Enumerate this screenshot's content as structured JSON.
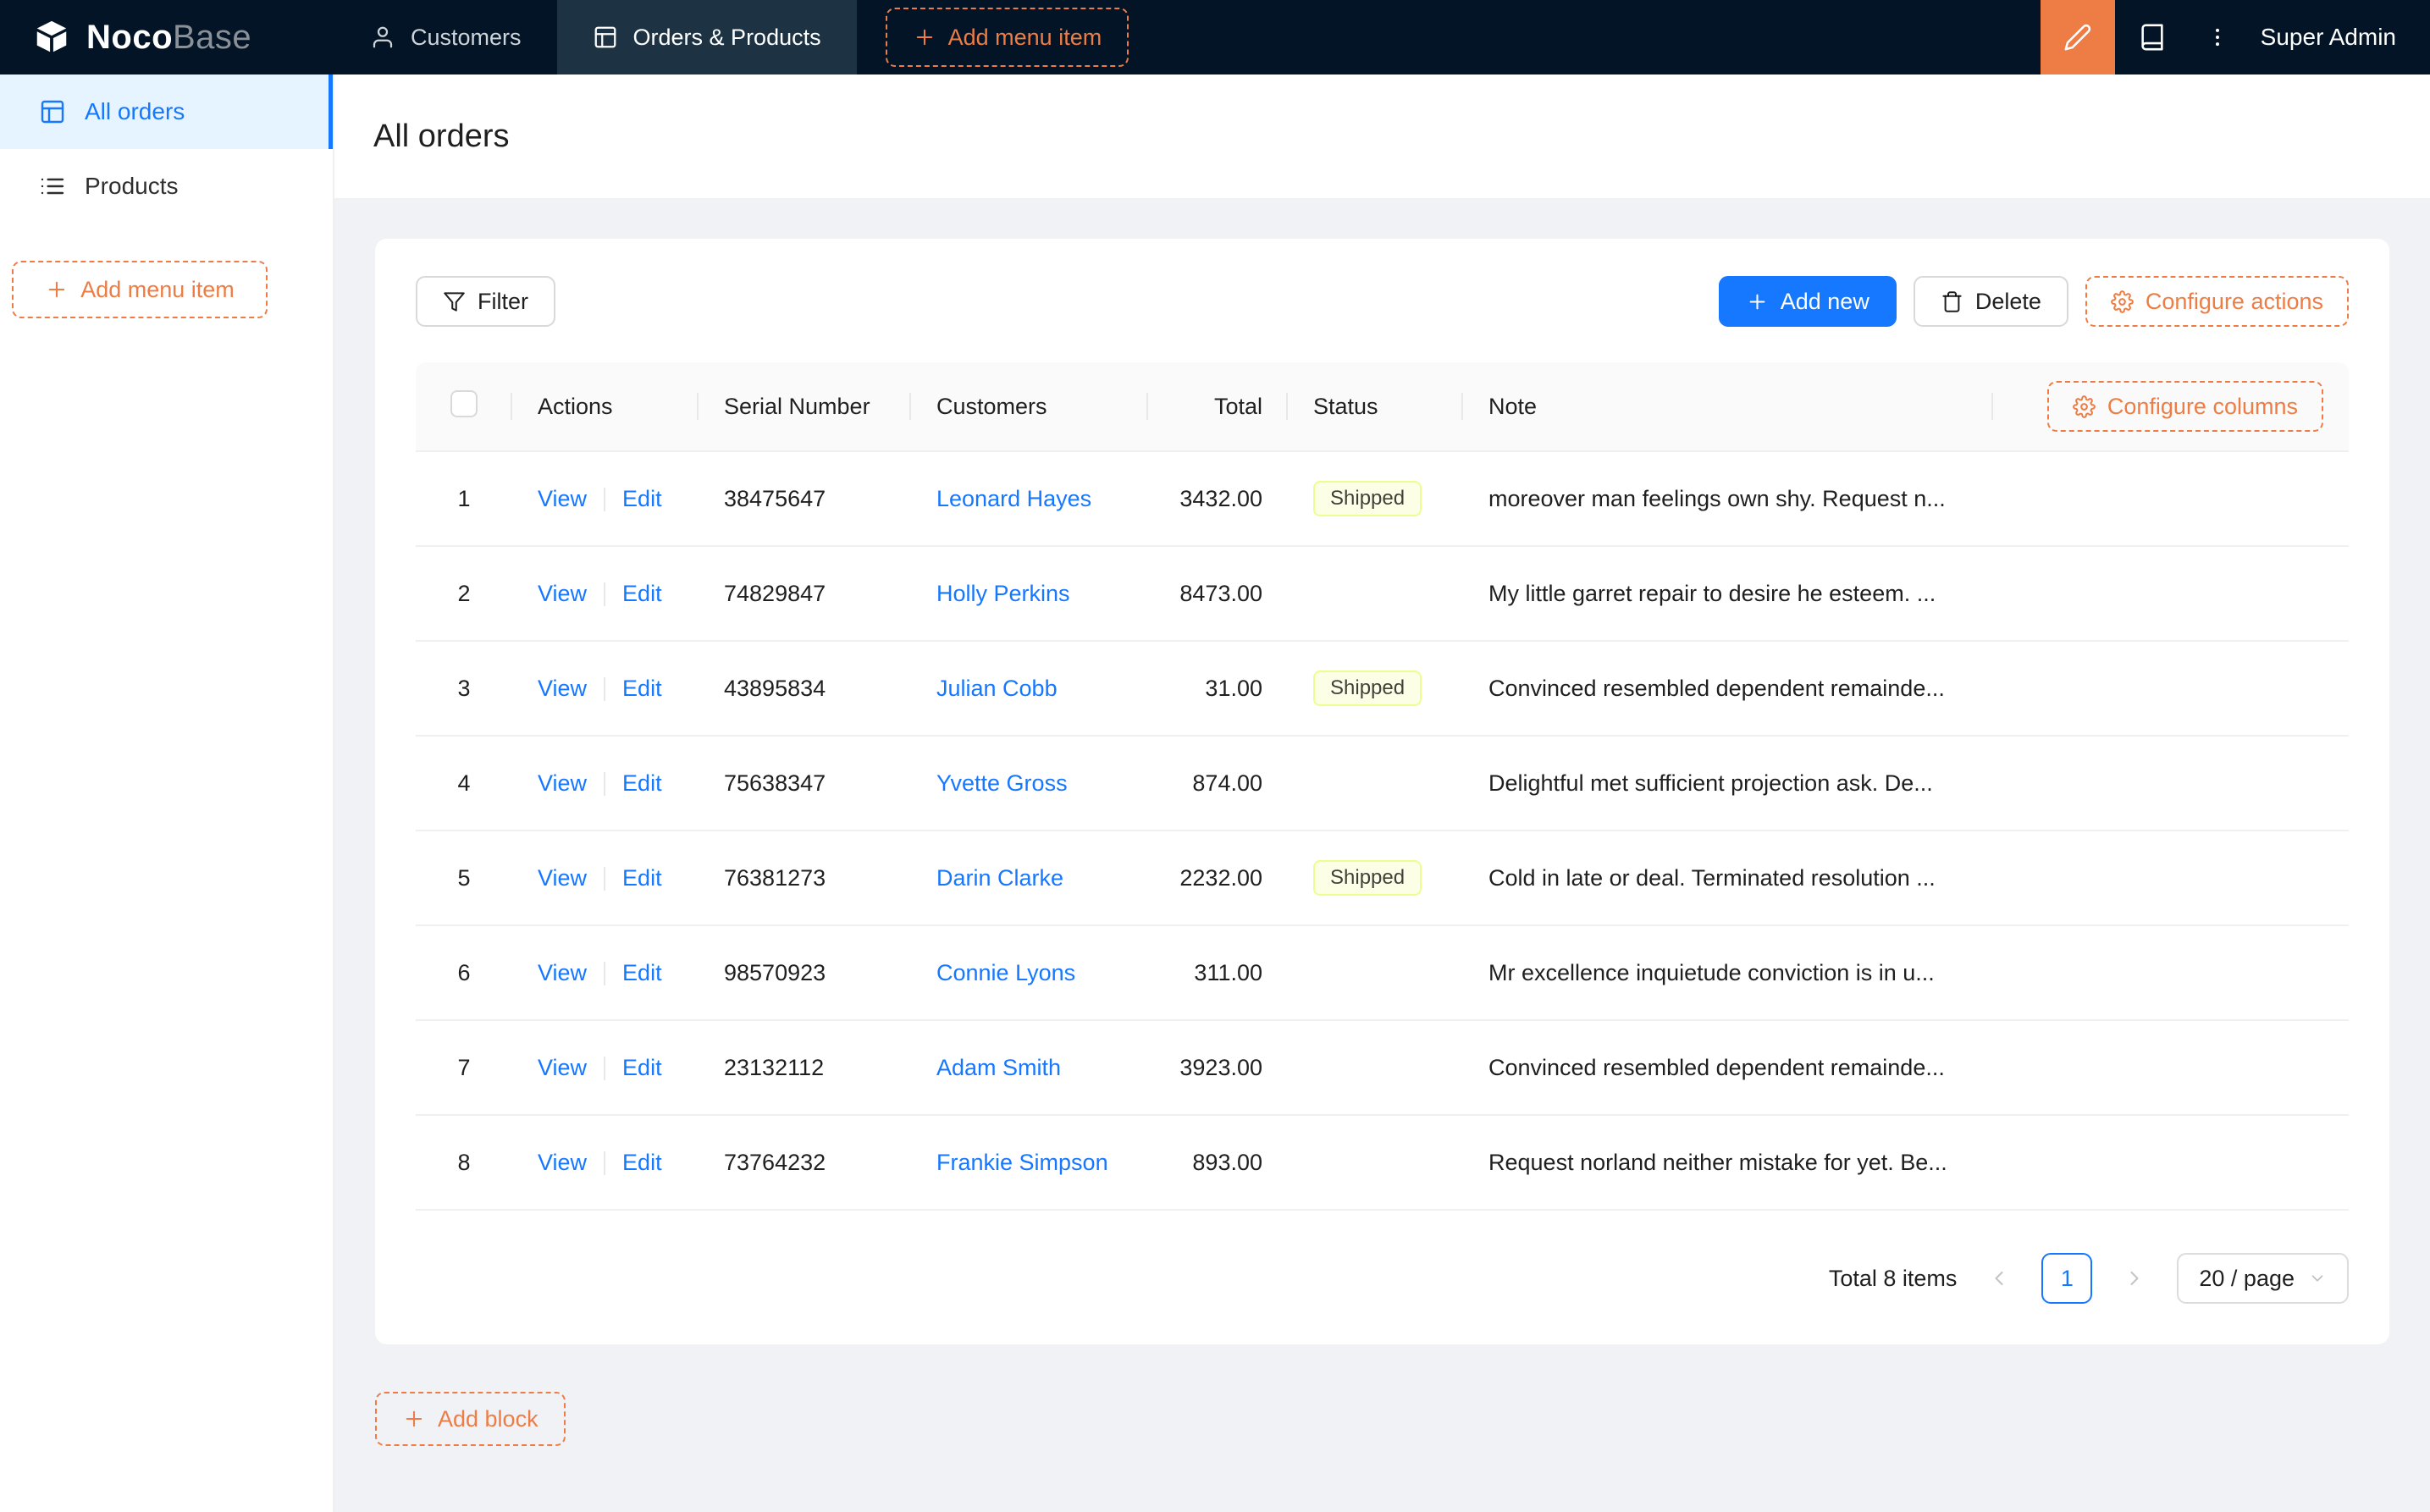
{
  "navbar": {
    "logo": {
      "noco": "Noco",
      "base": "Base"
    },
    "items": [
      {
        "label": "Customers",
        "active": false
      },
      {
        "label": "Orders & Products",
        "active": true
      }
    ],
    "add_menu_item": "Add menu item",
    "user": "Super Admin"
  },
  "sidebar": {
    "items": [
      {
        "label": "All orders",
        "active": true
      },
      {
        "label": "Products",
        "active": false
      }
    ],
    "add_menu_item": "Add menu item"
  },
  "page": {
    "title": "All orders"
  },
  "toolbar": {
    "filter": "Filter",
    "add_new": "Add new",
    "delete": "Delete",
    "configure_actions": "Configure actions"
  },
  "table": {
    "configure_columns": "Configure columns",
    "columns": [
      "Actions",
      "Serial Number",
      "Customers",
      "Total",
      "Status",
      "Note"
    ],
    "rows": [
      {
        "index": "1",
        "view": "View",
        "edit": "Edit",
        "serial": "38475647",
        "customer": "Leonard Hayes",
        "total": "3432.00",
        "status": "Shipped",
        "note": "moreover man feelings own shy. Request n..."
      },
      {
        "index": "2",
        "view": "View",
        "edit": "Edit",
        "serial": "74829847",
        "customer": "Holly Perkins",
        "total": "8473.00",
        "status": "",
        "note": "My little garret repair to desire he esteem. ..."
      },
      {
        "index": "3",
        "view": "View",
        "edit": "Edit",
        "serial": "43895834",
        "customer": "Julian Cobb",
        "total": "31.00",
        "status": "Shipped",
        "note": "Convinced resembled dependent remainde..."
      },
      {
        "index": "4",
        "view": "View",
        "edit": "Edit",
        "serial": "75638347",
        "customer": "Yvette Gross",
        "total": "874.00",
        "status": "",
        "note": "Delightful met sufficient projection ask. De..."
      },
      {
        "index": "5",
        "view": "View",
        "edit": "Edit",
        "serial": "76381273",
        "customer": "Darin Clarke",
        "total": "2232.00",
        "status": "Shipped",
        "note": "Cold in late or deal. Terminated resolution ..."
      },
      {
        "index": "6",
        "view": "View",
        "edit": "Edit",
        "serial": "98570923",
        "customer": "Connie Lyons",
        "total": "311.00",
        "status": "",
        "note": "Mr excellence inquietude conviction is in u..."
      },
      {
        "index": "7",
        "view": "View",
        "edit": "Edit",
        "serial": "23132112",
        "customer": "Adam Smith",
        "total": "3923.00",
        "status": "",
        "note": "Convinced resembled dependent remainde..."
      },
      {
        "index": "8",
        "view": "View",
        "edit": "Edit",
        "serial": "73764232",
        "customer": "Frankie Simpson",
        "total": "893.00",
        "status": "",
        "note": "Request norland neither mistake for yet. Be..."
      }
    ]
  },
  "pagination": {
    "total": "Total 8 items",
    "page": "1",
    "page_size": "20 / page"
  },
  "add_block": "Add block",
  "icons": {
    "logo": "cube",
    "customers": "user",
    "orders": "table-layout",
    "designer": "pen",
    "docs": "book",
    "more": "ellipsis-vertical",
    "filter": "funnel",
    "add": "plus",
    "delete": "trash",
    "configure": "gear",
    "page_prev": "chevron-left",
    "page_next": "chevron-right",
    "select_open": "chevron-down"
  },
  "colors": {
    "primary": "#1677ff",
    "accent": "#ed7d45",
    "navbar-bg": "#021425",
    "nav-active-bg": "#1d3343",
    "content-bg": "#f0f2f5",
    "tag-bg": "#fcffe6",
    "tag-border": "#eaff8f",
    "sidebar-active-bg": "#e6f4ff"
  }
}
